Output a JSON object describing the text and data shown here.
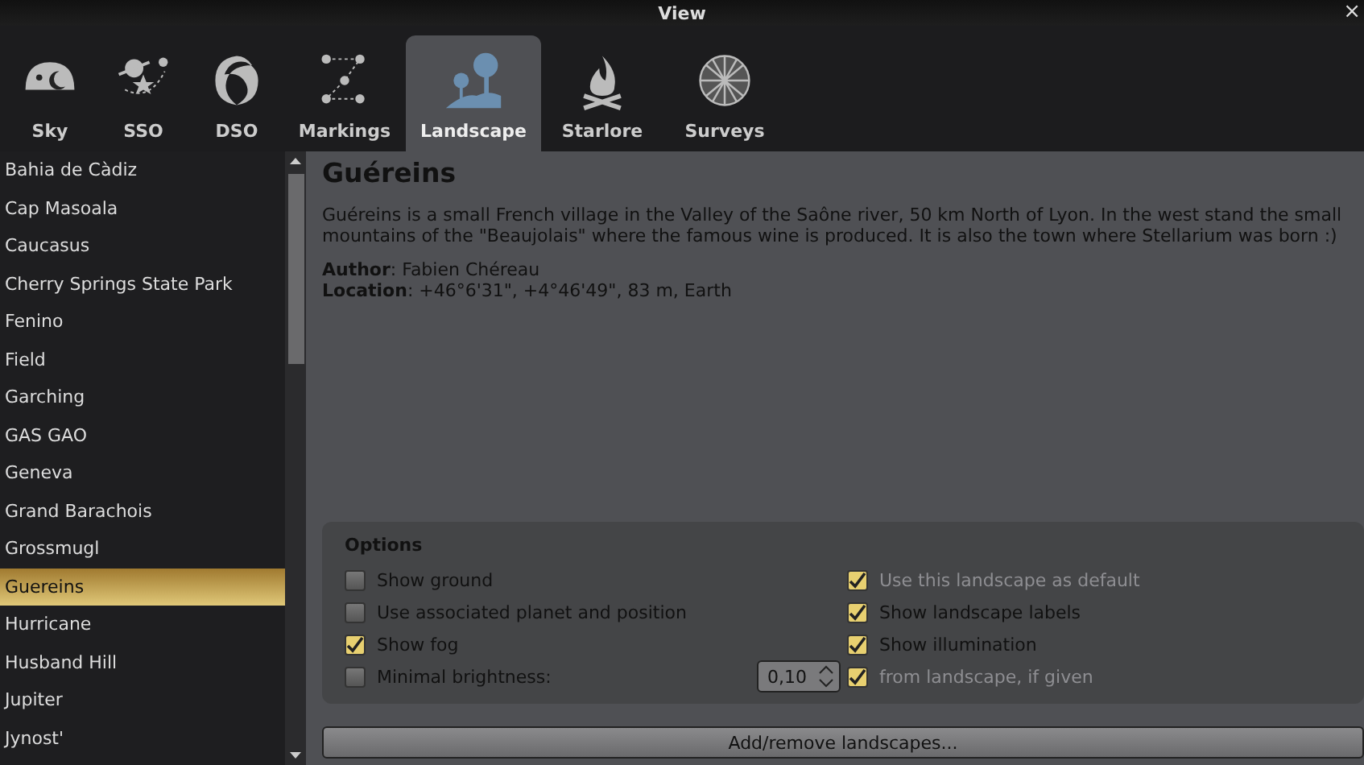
{
  "window": {
    "title": "View",
    "close": "×"
  },
  "tabs": [
    {
      "label": "Sky",
      "selected": false
    },
    {
      "label": "SSO",
      "selected": false
    },
    {
      "label": "DSO",
      "selected": false
    },
    {
      "label": "Markings",
      "selected": false
    },
    {
      "label": "Landscape",
      "selected": true
    },
    {
      "label": "Starlore",
      "selected": false
    },
    {
      "label": "Surveys",
      "selected": false
    }
  ],
  "landscapes": [
    {
      "name": "Bahia de Càdiz",
      "selected": false
    },
    {
      "name": "Cap Masoala",
      "selected": false
    },
    {
      "name": "Caucasus",
      "selected": false
    },
    {
      "name": "Cherry Springs State Park",
      "selected": false
    },
    {
      "name": "Fenino",
      "selected": false
    },
    {
      "name": "Field",
      "selected": false
    },
    {
      "name": "Garching",
      "selected": false
    },
    {
      "name": "GAS GAO",
      "selected": false
    },
    {
      "name": "Geneva",
      "selected": false
    },
    {
      "name": "Grand Barachois",
      "selected": false
    },
    {
      "name": "Grossmugl",
      "selected": false
    },
    {
      "name": "Guereins",
      "selected": true
    },
    {
      "name": "Hurricane",
      "selected": false
    },
    {
      "name": "Husband Hill",
      "selected": false
    },
    {
      "name": "Jupiter",
      "selected": false
    },
    {
      "name": "Jynost'",
      "selected": false
    }
  ],
  "details": {
    "title": "Guéreins",
    "description": "Guéreins is a small French village in the Valley of the Saône river, 50 km North of Lyon. In the west stand the small mountains of the \"Beaujolais\" where the famous wine is produced. It is also the town where Stellarium was born :)",
    "author": "**Author**: Fabien Chéreau",
    "location": "**Location**: +46°6'31\", +4°46'49\", 83 m, Earth"
  },
  "options": {
    "title": "Options",
    "left": [
      {
        "label": "Show ground",
        "checked": false,
        "disabled": false
      },
      {
        "label": "Use associated planet and position",
        "checked": false,
        "disabled": false
      },
      {
        "label": "Show fog",
        "checked": true,
        "disabled": false
      },
      {
        "label": "Minimal brightness:",
        "checked": false,
        "disabled": false,
        "spin_value": "0,10"
      }
    ],
    "right": [
      {
        "label": "Use this landscape as default",
        "checked": true,
        "disabled": true
      },
      {
        "label": "Show landscape labels",
        "checked": true,
        "disabled": false
      },
      {
        "label": "Show illumination",
        "checked": true,
        "disabled": false
      },
      {
        "label": "from landscape, if given",
        "checked": true,
        "disabled": true
      }
    ]
  },
  "add_button": "Add/remove landscapes..."
}
